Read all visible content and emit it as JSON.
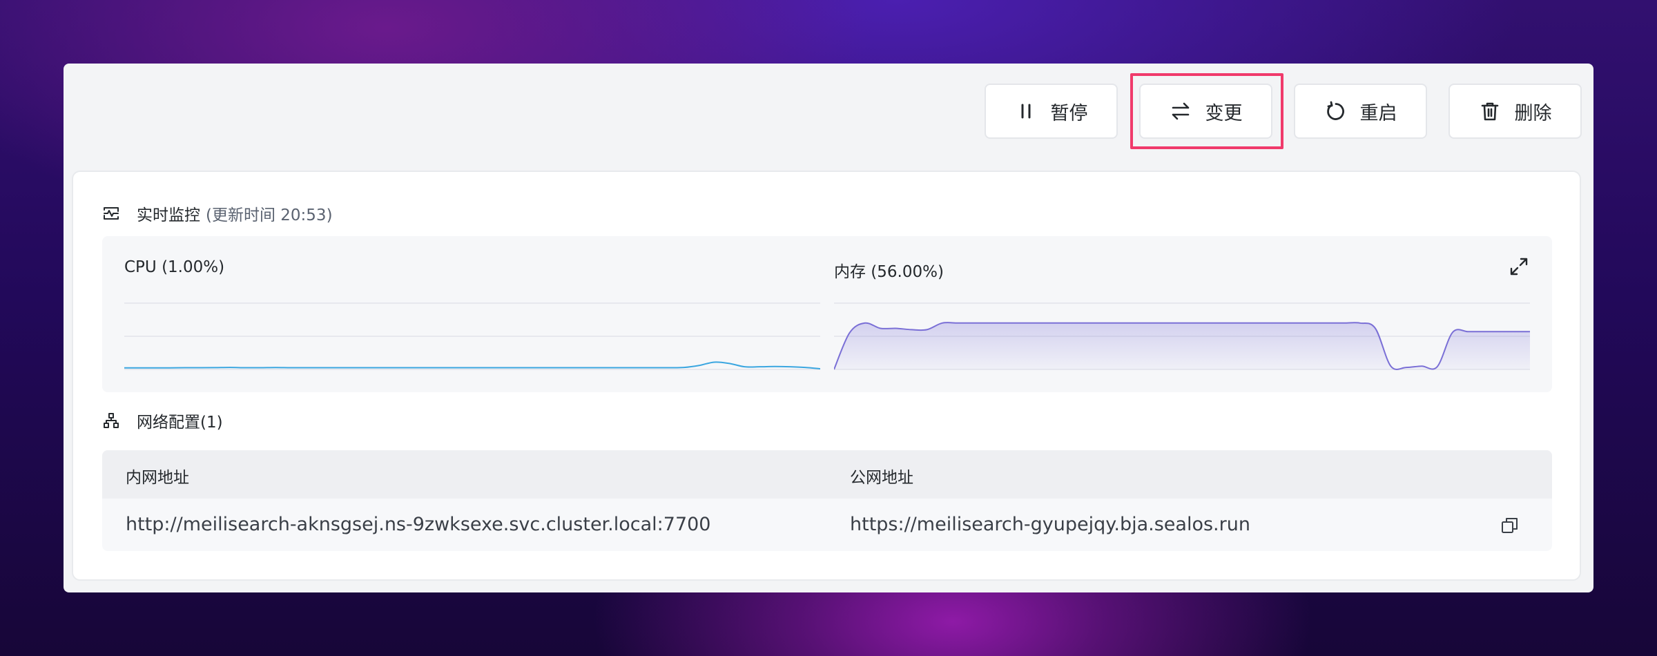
{
  "toolbar": {
    "pause": {
      "label": "暂停",
      "icon": "pause-icon"
    },
    "change": {
      "label": "变更",
      "icon": "swap-arrows-icon"
    },
    "restart": {
      "label": "重启",
      "icon": "restart-icon"
    },
    "delete": {
      "label": "删除",
      "icon": "trash-icon"
    },
    "highlight_color": "#f03a6b"
  },
  "monitor": {
    "title": "实时监控",
    "update_time": "(更新时间  20:53)",
    "cpu_label": "CPU  (1.00%)",
    "memory_label": "内存  (56.00%)",
    "expand_icon": "expand-icon"
  },
  "chart_data": [
    {
      "type": "line",
      "title": "CPU  (1.00%)",
      "ylim": [
        0,
        100
      ],
      "grid": true,
      "color": "#3aa6e0",
      "values": [
        2.4,
        2.4,
        2.3,
        2.4,
        2.6,
        2.6,
        2.7,
        3.0,
        2.6,
        2.6,
        2.9,
        2.6,
        2.6,
        2.6,
        2.6,
        2.6,
        2.6,
        2.6,
        2.6,
        2.6,
        2.6,
        2.6,
        2.6,
        2.6,
        2.6,
        2.6,
        2.6,
        2.6,
        2.6,
        2.6,
        2.6,
        2.6,
        2.6,
        2.6,
        2.6,
        2.6,
        2.6,
        3.0,
        6.0,
        11.0,
        9.0,
        4.0,
        4.0,
        4.4,
        4.0,
        3.0,
        1.0
      ]
    },
    {
      "type": "area",
      "title": "内存  (56.00%)",
      "ylim": [
        0,
        100
      ],
      "grid": true,
      "color": "#7a6fd6",
      "values": [
        0,
        55,
        70,
        62,
        62,
        60,
        60,
        70,
        70,
        70,
        70,
        70,
        70,
        70,
        70,
        70,
        70,
        70,
        70,
        70,
        70,
        70,
        70,
        70,
        70,
        70,
        70,
        70,
        70,
        70,
        70,
        70,
        70,
        70,
        70,
        62,
        5,
        3,
        5,
        4,
        56,
        57,
        57,
        57,
        57,
        57
      ]
    }
  ],
  "network": {
    "title": "网络配置(1)",
    "headers": [
      "内网地址",
      "公网地址"
    ],
    "row": {
      "internal": "http://meilisearch-aknsgsej.ns-9zwksexe.svc.cluster.local:7700",
      "public": "https://meilisearch-gyupejqy.bja.sealos.run",
      "copy_icon": "copy-icon"
    }
  }
}
